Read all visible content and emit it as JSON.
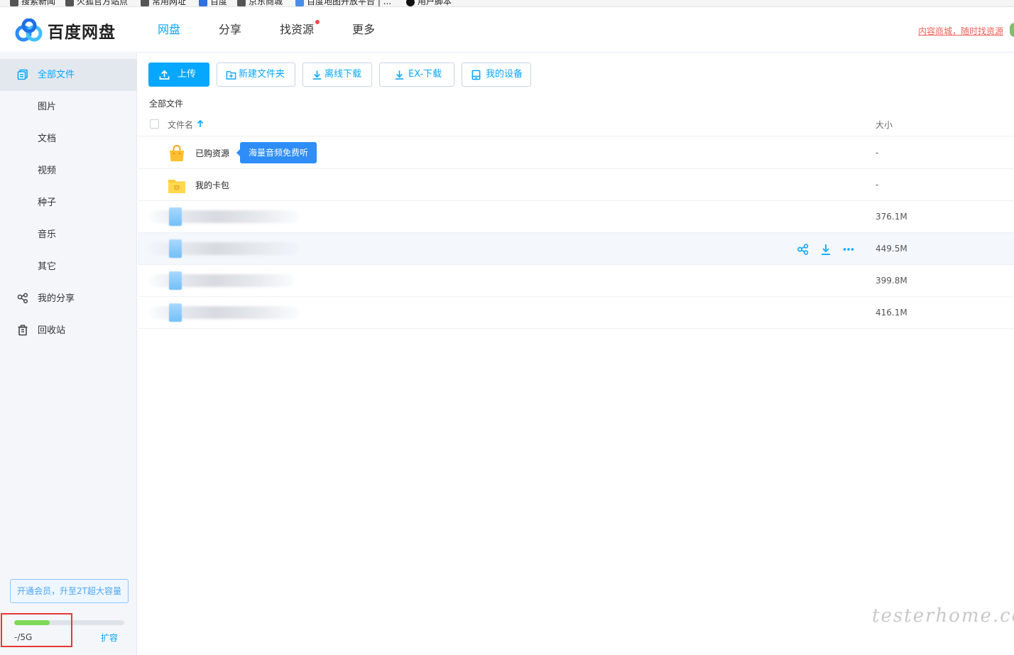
{
  "bookmarks": [
    "搜索新闻",
    "火狐官方站点",
    "常用网址",
    "百度",
    "京东商城",
    "百度地图开放平台 | ...",
    "用户脚本"
  ],
  "header": {
    "logo_text": "百度网盘",
    "nav": [
      {
        "label": "网盘",
        "active": true
      },
      {
        "label": "分享",
        "active": false
      },
      {
        "label": "找资源",
        "active": false,
        "dot": true
      },
      {
        "label": "更多",
        "active": false
      }
    ],
    "promo_link": "内容商城，随时找资源"
  },
  "sidebar": {
    "items": [
      {
        "label": "全部文件",
        "icon": "all-files-icon",
        "active": true
      },
      {
        "label": "图片"
      },
      {
        "label": "文档"
      },
      {
        "label": "视频"
      },
      {
        "label": "种子"
      },
      {
        "label": "音乐"
      },
      {
        "label": "其它"
      },
      {
        "label": "我的分享",
        "icon": "share-icon"
      },
      {
        "label": "回收站",
        "icon": "trash-icon"
      }
    ],
    "vip_button": "开通会员，升至2T超大容量",
    "quota_text": "-/5G",
    "quota_fraction": 0.32,
    "expand_label": "扩容"
  },
  "toolbar": {
    "upload": "上传",
    "new_folder": "新建文件夹",
    "offline_download": "离线下载",
    "ex_download": "EX-下载",
    "my_devices": "我的设备"
  },
  "breadcrumb": "全部文件",
  "table": {
    "col_name": "文件名",
    "col_size": "大小",
    "rows": [
      {
        "name": "已购资源",
        "size": "-",
        "icon": "shopping-bag-icon",
        "tooltip": "海量音频免费听"
      },
      {
        "name": "我的卡包",
        "size": "-",
        "icon": "wallet-folder-icon"
      },
      {
        "name": "",
        "size": "376.1M",
        "blurred": true
      },
      {
        "name": "",
        "size": "449.5M",
        "blurred": true,
        "hover": true
      },
      {
        "name": "",
        "size": "399.8M",
        "blurred": true
      },
      {
        "name": "",
        "size": "416.1M",
        "blurred": true
      }
    ]
  },
  "watermark": "testerhome.com",
  "colors": {
    "accent": "#06a7ff",
    "quota_fill": "#7ed957",
    "promo": "#f06057"
  }
}
